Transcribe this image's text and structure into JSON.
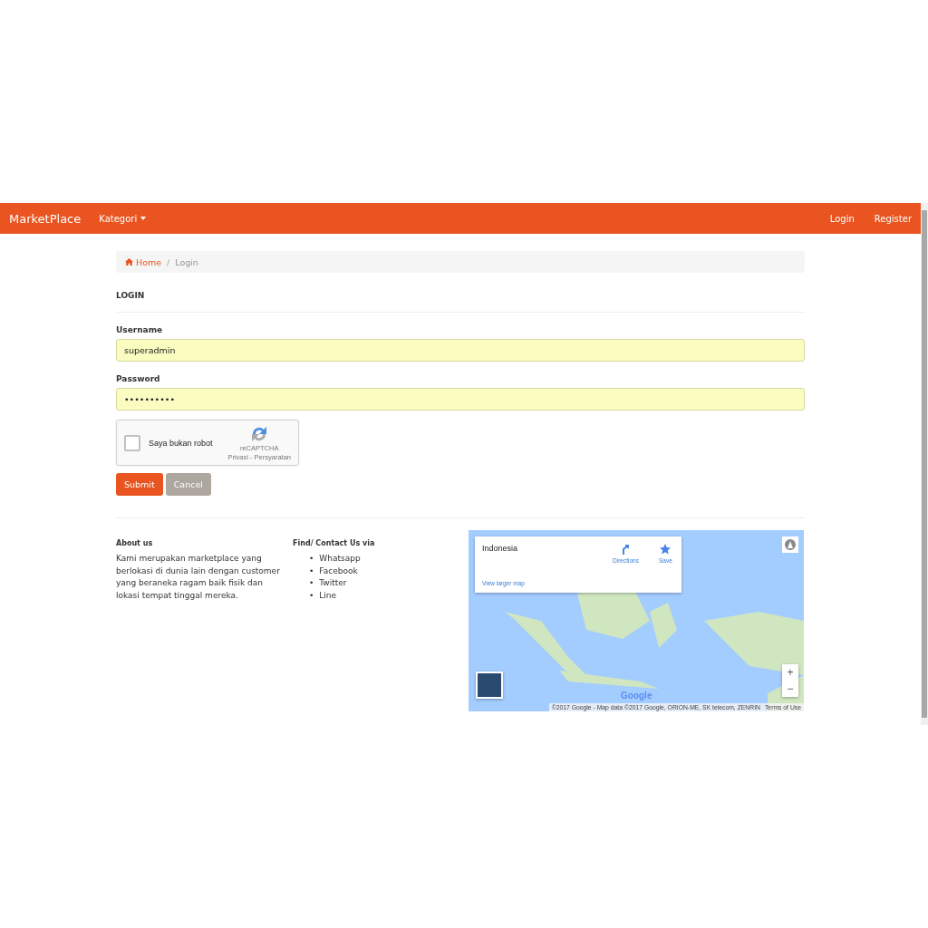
{
  "navbar": {
    "brand": "MarketPlace",
    "menu": [
      {
        "label": "Kategori",
        "kind": "dropdown"
      }
    ],
    "right_links": [
      "Login",
      "Register"
    ]
  },
  "breadcrumb_separator": "/",
  "breadcrumb": [
    {
      "label": "Home",
      "kind": "link"
    },
    {
      "label": "Login",
      "kind": "current"
    }
  ],
  "form": {
    "title": "LOGIN",
    "fields": [
      {
        "label": "Username",
        "value": "superadmin",
        "autofilled": true
      },
      {
        "label": "Password",
        "value": "••••••••••",
        "autofilled": true
      }
    ],
    "captcha": {
      "label": "Saya bukan robot",
      "checked": false,
      "brand": "reCAPTCHA",
      "terms": "Privasi - Persyaratan"
    },
    "buttons": [
      {
        "label": "Submit",
        "kind": "primary"
      },
      {
        "label": "Cancel",
        "kind": "secondary"
      }
    ]
  },
  "footer": {
    "about": {
      "title": "About us",
      "text": "Kami merupakan marketplace yang berlokasi di dunia lain dengan customer yang beraneka ragam baik fisik dan lokasi tempat tinggal mereka."
    },
    "contact": {
      "title": "Find/ Contact Us via",
      "bullet": "•",
      "items": [
        "Whatsapp",
        "Facebook",
        "Twitter",
        "Line"
      ]
    },
    "map": {
      "place": "Indonesia",
      "directions": "Directions",
      "save": "Save",
      "larger": "View larger map",
      "zoom_in": "+",
      "zoom_out": "−",
      "logo": "Google",
      "attribution": "©2017 Google - Map data ©2017 Google, ORION-ME, SK telecom, ZENRIN",
      "terms": "Terms of Use"
    }
  }
}
